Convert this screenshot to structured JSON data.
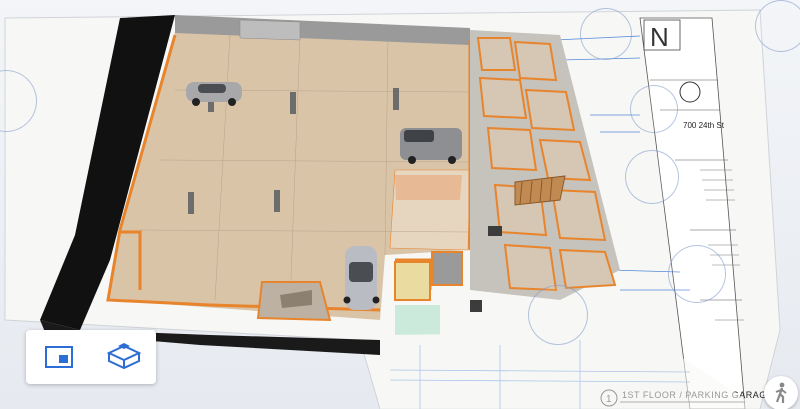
{
  "sheet": {
    "north_label": "N",
    "address": "700 24th St",
    "sheet_number": "1",
    "sheet_title": "1ST FLOOR / PARKING GARAGE"
  },
  "toolbar": {
    "items": [
      {
        "icon": "sheet-view-icon"
      },
      {
        "icon": "model-3d-view-icon"
      }
    ]
  },
  "walk_button": {
    "icon": "walk-person-icon"
  },
  "colors": {
    "accent_blue": "#2c6ed5",
    "wall_orange": "#e8842c",
    "floor_tan": "#d9c4a8",
    "wall_black": "#111111"
  }
}
